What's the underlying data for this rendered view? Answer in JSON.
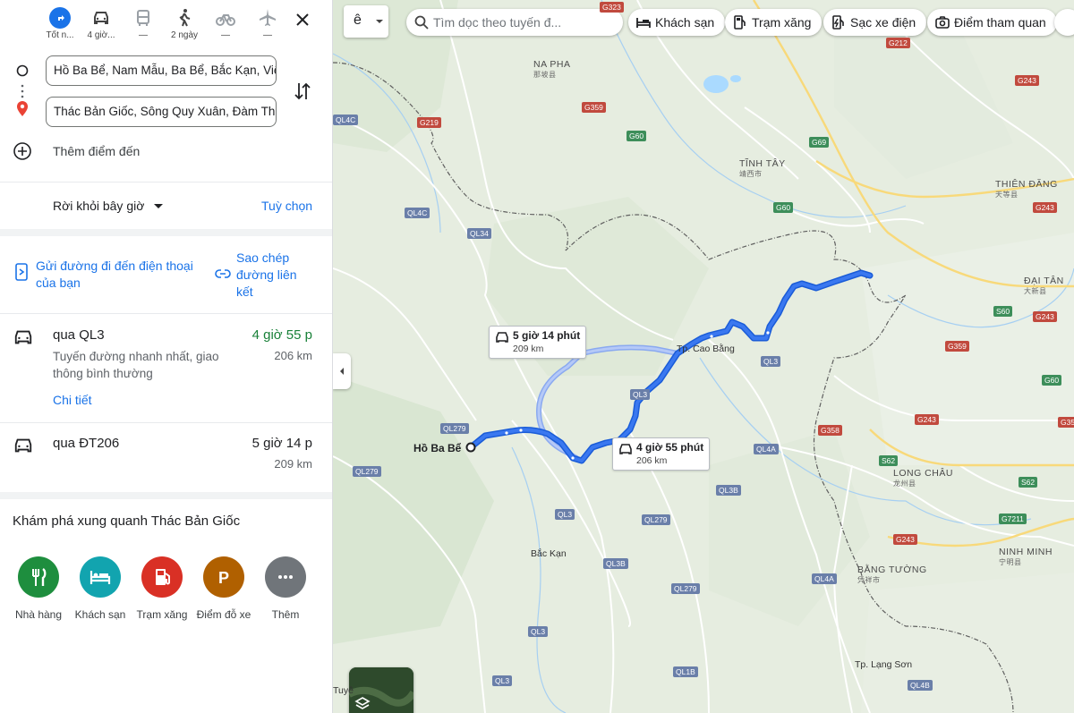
{
  "modes": [
    {
      "icon": "directions-icon",
      "label": "Tốt n..."
    },
    {
      "icon": "car-icon",
      "label": "4 giờ..."
    },
    {
      "icon": "bus-icon",
      "label": "—"
    },
    {
      "icon": "walk-icon",
      "label": "2 ngày"
    },
    {
      "icon": "bike-icon",
      "label": "—"
    },
    {
      "icon": "plane-icon",
      "label": "—"
    }
  ],
  "inputs": {
    "origin": "Hồ Ba Bể, Nam Mẫu, Ba Bể, Bắc Kạn, Việt Nam",
    "destination": "Thác Bản Giốc, Sông Quy Xuân, Đàm Thủy",
    "add_stop": "Thêm điểm đến"
  },
  "depart": {
    "label": "Rời khỏi bây giờ",
    "options": "Tuỳ chọn"
  },
  "share": {
    "send_phone": "Gửi đường đi đến điện thoại của bạn",
    "copy_link": "Sao chép đường liên kết"
  },
  "routes": [
    {
      "name": "qua QL3",
      "time": "4 giờ 55 p",
      "desc": "Tuyến đường nhanh nhất, giao thông bình thường",
      "dist": "206 km",
      "details": "Chi tiết"
    },
    {
      "name": "qua ĐT206",
      "time": "5 giờ 14 p",
      "dist": "209 km"
    }
  ],
  "explore": {
    "title": "Khám phá xung quanh Thác Bản Giốc",
    "items": [
      {
        "label": "Nhà hàng",
        "icon": "restaurant-icon",
        "color": "#1e8e3e"
      },
      {
        "label": "Khách sạn",
        "icon": "hotel-icon",
        "color": "#12a4af"
      },
      {
        "label": "Trạm xăng",
        "icon": "gas-icon",
        "color": "#d93025"
      },
      {
        "label": "Điểm đỗ xe",
        "icon": "parking-icon",
        "color": "#b06000"
      },
      {
        "label": "Thêm",
        "icon": "more-icon",
        "color": "#70757a"
      }
    ]
  },
  "map": {
    "lang_btn": "ê",
    "search_placeholder": "Tìm dọc theo tuyến đ...",
    "chips": [
      "Khách sạn",
      "Trạm xăng",
      "Sạc xe điện",
      "Điểm tham quan"
    ],
    "tag_fast": {
      "time": "4 giờ 55 phút",
      "dist": "206 km"
    },
    "tag_alt": {
      "time": "5 giờ 14 phút",
      "dist": "209 km"
    },
    "origin_label": "Hồ Ba Bể",
    "places": {
      "na_pha": "NA PHA",
      "na_pha_cn": "那坡县",
      "tinh_tay": "TĨNH TÂY",
      "tinh_tay_cn": "靖西市",
      "thien_dang": "THIÊN ĐĂNG",
      "thien_dang_cn": "天等县",
      "dai_tan": "ĐẠI TÂN",
      "dai_tan_cn": "大新县",
      "cao_bang": "Tp. Cao Bằng",
      "long_chau": "LONG CHÂU",
      "long_chau_cn": "龙州县",
      "ninh_minh": "NINH MINH",
      "ninh_minh_cn": "宁明县",
      "bang_tuong": "BẰNG TƯỜNG",
      "bang_tuong_cn": "凭祥市",
      "bac_kan": "Bắc Kạn",
      "lang_son": "Tp. Lạng Sơn",
      "tuyen": "Tuyê"
    },
    "roads": {
      "g212": "G212",
      "g243a": "G243",
      "g323": "G323",
      "g359a": "G359",
      "g60a": "G60",
      "g69": "G69",
      "g60b": "G60",
      "g243b": "G243",
      "g219": "G219",
      "ql4c_a": "QL4C",
      "ql4c_b": "QL4C",
      "ql34": "QL34",
      "s60a": "S60",
      "g243c": "G243",
      "g359b": "G359",
      "g60c": "G60",
      "ql3a": "QL3",
      "ql3b": "QL3",
      "ql4a_a": "QL4A",
      "g243d": "G243",
      "g358": "G358",
      "s62a": "S62",
      "s62b": "S62",
      "ql279a": "QL279",
      "ql279b": "QL279",
      "ql3c": "QL3",
      "ql3b_a": "QL3B",
      "ql279c": "QL279",
      "ql3b_b": "QL3B",
      "ql279d": "QL279",
      "ql4a_b": "QL4A",
      "g7211": "G7211",
      "g243e": "G243",
      "ql3d": "QL3",
      "ql1b": "QL1B",
      "ql3e": "QL3",
      "ql4b": "QL4B",
      "g35": "G35"
    }
  }
}
